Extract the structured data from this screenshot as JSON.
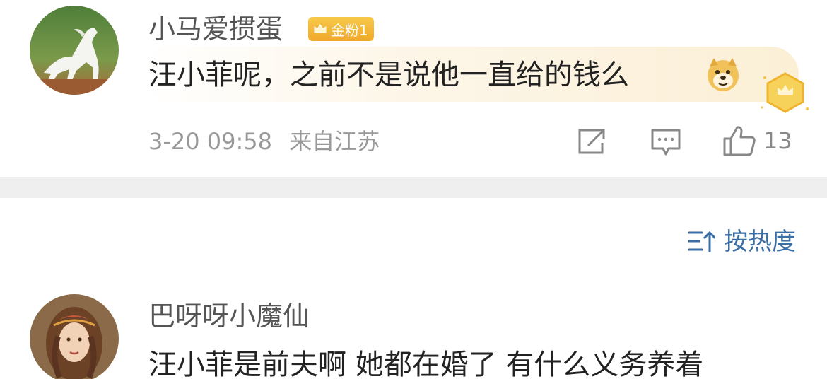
{
  "comments": [
    {
      "username": "小马爱掼蛋",
      "badge": "金粉1",
      "text": "汪小菲呢，之前不是说他一直给的钱么",
      "emoji": "doge-emoji",
      "timestamp": "3-20 09:58",
      "location": "来自江苏",
      "likes": "13",
      "avatar": "white-horse-avatar"
    },
    {
      "username": "巴呀呀小魔仙",
      "text": "汪小菲是前夫啊  她都在婚了 有什么义务养着",
      "avatar": "woman-portrait-avatar"
    }
  ],
  "sort": {
    "label": "按热度",
    "icon": "sort-icon"
  },
  "colors": {
    "link": "#3b6ea5",
    "meta": "#999999",
    "badge": "#f0a92d",
    "divider": "#efefef"
  }
}
